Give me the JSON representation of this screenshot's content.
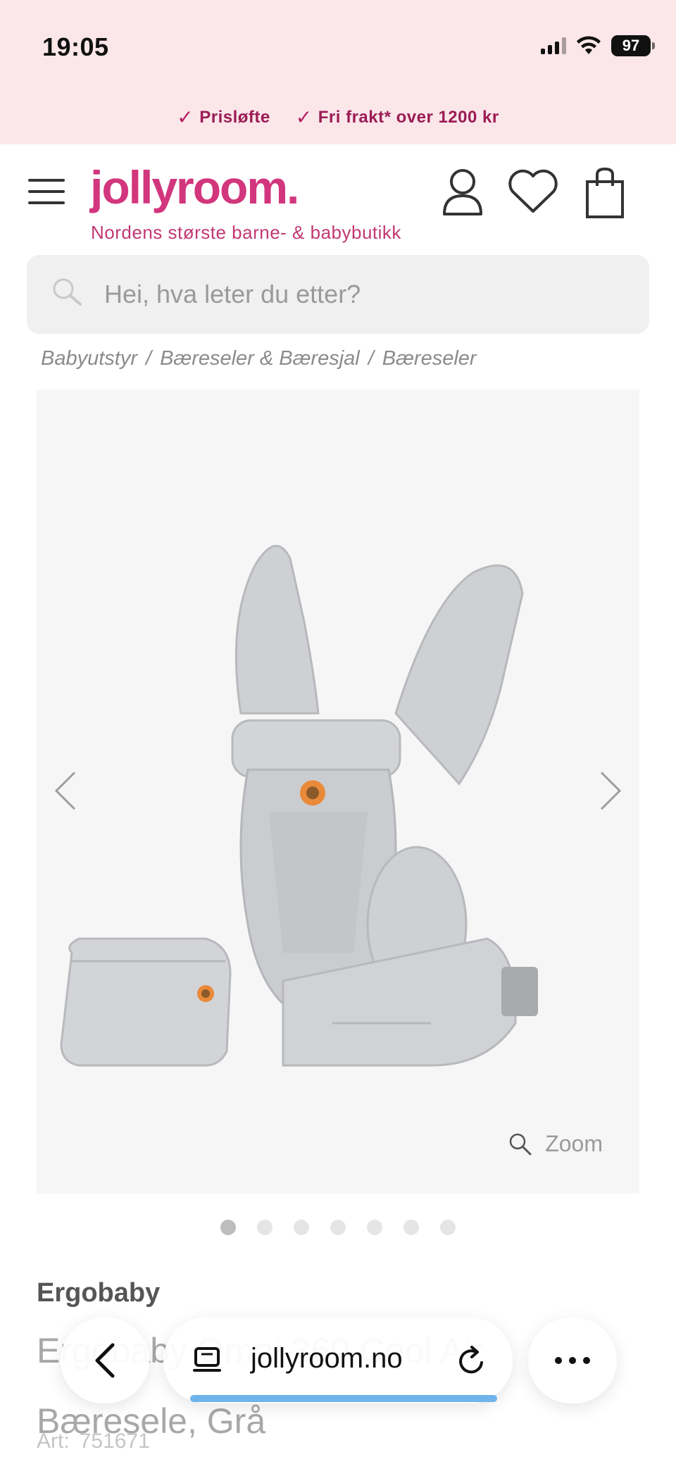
{
  "status_bar": {
    "time": "19:05",
    "battery": "97"
  },
  "promo": {
    "items": [
      "Prisløfte",
      "Fri frakt* over 1200 kr"
    ]
  },
  "header": {
    "logo": "jollyroom.",
    "tagline": "Nordens største barne- & babybutikk",
    "icons": [
      "menu-icon",
      "user-icon",
      "heart-icon",
      "shopping-bag-icon"
    ]
  },
  "search": {
    "placeholder": "Hei, hva leter du etter?"
  },
  "breadcrumb": {
    "items": [
      "Babyutstyr",
      "Bæreseler & Bæresjal",
      "Bæreseler"
    ],
    "separator": "/"
  },
  "gallery": {
    "zoom_label": "Zoom",
    "slide_count": 7,
    "active_slide": 1
  },
  "product": {
    "brand": "Ergobaby",
    "title": "Ergobaby Omni 360 Cool Air Bæresele, Grå",
    "art_label": "Art:",
    "art_number": "751671"
  },
  "browser": {
    "url": "jollyroom.no",
    "load_progress": 0.85
  },
  "colors": {
    "brand_pink": "#d2367d",
    "promo_bg": "#fbe6ea",
    "promo_text": "#9b1c55",
    "progress": "#6fb3ea"
  }
}
